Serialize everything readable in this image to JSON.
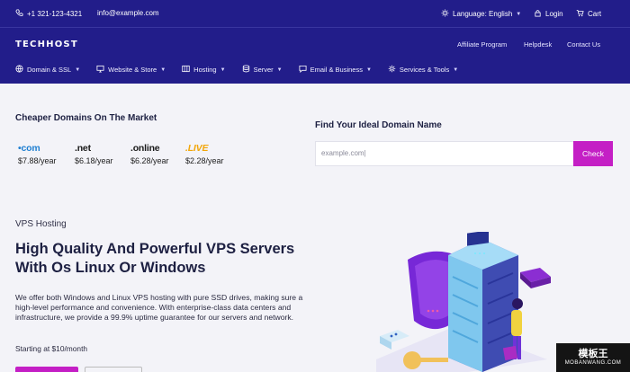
{
  "topbar": {
    "phone": "+1 321-123-4321",
    "email": "info@example.com",
    "language": "Language: English",
    "login": "Login",
    "cart": "Cart"
  },
  "header": {
    "logo": "TECHHOST",
    "links": [
      "Affiliate Program",
      "Helpdesk",
      "Contact Us"
    ],
    "menu": [
      {
        "label": "Domain & SSL",
        "icon": "globe-icon"
      },
      {
        "label": "Website & Store",
        "icon": "monitor-icon"
      },
      {
        "label": "Hosting",
        "icon": "server-rack-icon"
      },
      {
        "label": "Server",
        "icon": "database-icon"
      },
      {
        "label": "Email & Business",
        "icon": "chat-icon"
      },
      {
        "label": "Services & Tools",
        "icon": "cog-icon"
      }
    ]
  },
  "domains": {
    "title": "Cheaper Domains On The Market",
    "tlds": [
      {
        "ext": "•com",
        "price": "$7.88/year",
        "color": "#1f7fd1"
      },
      {
        "ext": ".net",
        "price": "$6.18/year",
        "color": "#1a1a1a"
      },
      {
        "ext": ".online",
        "price": "$6.28/year",
        "color": "#1a1a1a"
      },
      {
        "ext": ".LIVE",
        "price": "$2.28/year",
        "color": "#f2a60a"
      }
    ]
  },
  "finder": {
    "title": "Find Your Ideal Domain Name",
    "placeholder": "example.com|",
    "button": "Check"
  },
  "vps": {
    "eyebrow": "VPS Hosting",
    "title": "High Quality And Powerful VPS Servers With Os Linux Or Windows",
    "body": "We offer both Windows and Linux VPS hosting with pure SSD drives, making sure a high-level performance and convenience. With enterprise-class data centers and infrastructure, we provide a 99.9% uptime guarantee for our servers and network.",
    "starting": "Starting at $10/month"
  },
  "watermark": {
    "line1": "模板王",
    "line2": "MOBANWANG.COM"
  },
  "colors": {
    "nav": "#221d8a",
    "accent": "#c41fc5",
    "background": "#f3f3f8"
  }
}
